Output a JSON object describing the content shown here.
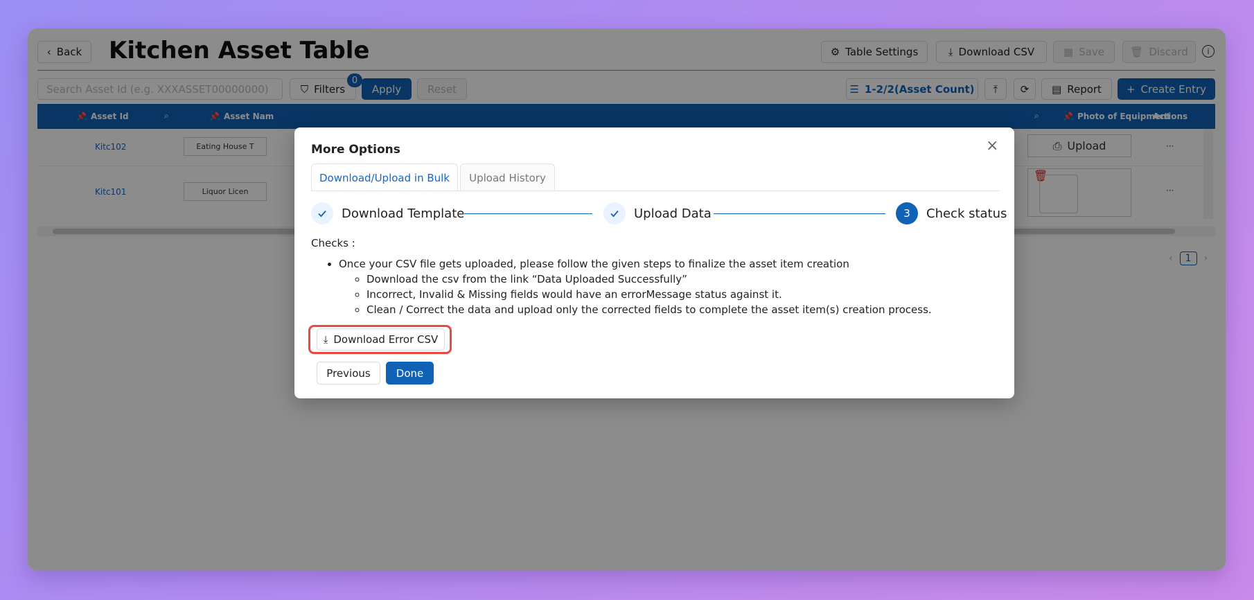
{
  "header": {
    "back_label": "Back",
    "title": "Kitchen Asset Table",
    "table_settings": "Table Settings",
    "download_csv": "Download CSV",
    "save": "Save",
    "discard": "Discard"
  },
  "toolbar": {
    "search_placeholder": "Search Asset Id (e.g. XXXASSET00000000)",
    "filters": "Filters",
    "filters_count": "0",
    "apply": "Apply",
    "reset": "Reset",
    "asset_count": "1-2/2(Asset Count)",
    "report": "Report",
    "create_entry": "Create Entry"
  },
  "table": {
    "columns": [
      "Asset Id",
      "Asset Nam",
      "Photo of Equipment",
      "Actions"
    ],
    "rows": [
      {
        "asset_id": "Kitc102",
        "asset_name": "Eating House T",
        "photo": "Upload",
        "actions": "···"
      },
      {
        "asset_id": "Kitc101",
        "asset_name": "Liquor Licen",
        "photo": "",
        "actions": "···"
      }
    ]
  },
  "pagination": {
    "current_page": "1"
  },
  "modal": {
    "title": "More Options",
    "tabs": [
      "Download/Upload in Bulk",
      "Upload History"
    ],
    "steps": [
      {
        "label": "Download Template",
        "state": "done"
      },
      {
        "label": "Upload Data",
        "state": "done"
      },
      {
        "label": "Check status",
        "state": "current",
        "number": "3"
      }
    ],
    "checks_label": "Checks :",
    "main_point": "Once your CSV file gets uploaded, please follow the given steps to finalize the asset item creation",
    "sub_points": [
      "Download the csv from the link “Data Uploaded Successfully”",
      "Incorrect, Invalid & Missing fields would have an errorMessage status against it.",
      "Clean / Correct the data and upload only the corrected fields to complete the asset item(s) creation process."
    ],
    "download_error_csv": "Download Error CSV",
    "previous": "Previous",
    "done": "Done"
  },
  "colors": {
    "primary": "#0f62b6",
    "highlight": "#e84a3f"
  }
}
